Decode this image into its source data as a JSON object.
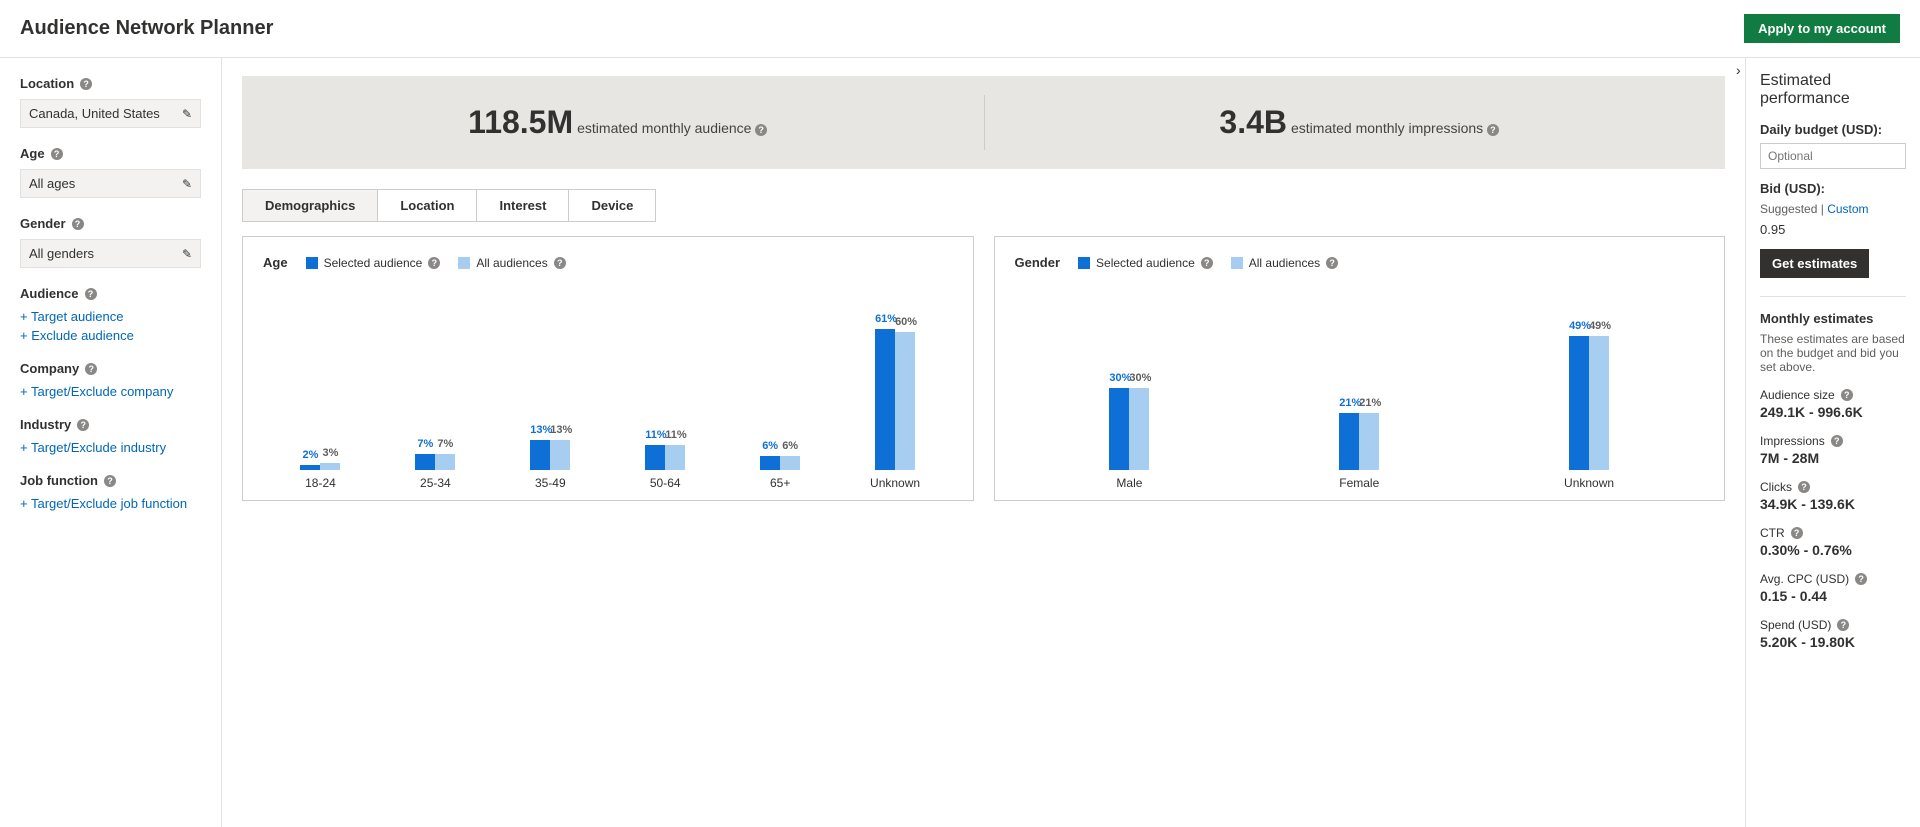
{
  "header": {
    "title": "Audience Network Planner",
    "apply_button": "Apply to my account"
  },
  "sidebar": {
    "location": {
      "label": "Location",
      "value": "Canada, United States"
    },
    "age": {
      "label": "Age",
      "value": "All ages"
    },
    "gender": {
      "label": "Gender",
      "value": "All genders"
    },
    "audience": {
      "label": "Audience",
      "target": "+ Target audience",
      "exclude": "+ Exclude audience"
    },
    "company": {
      "label": "Company",
      "link": "+ Target/Exclude company"
    },
    "industry": {
      "label": "Industry",
      "link": "+ Target/Exclude industry"
    },
    "jobfunction": {
      "label": "Job function",
      "link": "+ Target/Exclude job function"
    }
  },
  "summary": {
    "audience_value": "118.5M",
    "audience_label": "estimated monthly audience",
    "impressions_value": "3.4B",
    "impressions_label": "estimated monthly impressions"
  },
  "tabs": [
    "Demographics",
    "Location",
    "Interest",
    "Device"
  ],
  "charts": {
    "age": {
      "title": "Age",
      "legend1": "Selected audience",
      "legend2": "All audiences"
    },
    "gender": {
      "title": "Gender",
      "legend1": "Selected audience",
      "legend2": "All audiences"
    }
  },
  "rightpanel": {
    "title": "Estimated performance",
    "budget_label": "Daily budget (USD):",
    "budget_placeholder": "Optional",
    "bid_label": "Bid (USD):",
    "bid_suggested": "Suggested",
    "bid_custom": "Custom",
    "bid_value": "0.95",
    "get_estimates": "Get estimates",
    "monthly_title": "Monthly estimates",
    "monthly_desc": "These estimates are based on the budget and bid you set above.",
    "stats": {
      "audience_size": {
        "label": "Audience size",
        "value": "249.1K - 996.6K"
      },
      "impressions": {
        "label": "Impressions",
        "value": "7M - 28M"
      },
      "clicks": {
        "label": "Clicks",
        "value": "34.9K - 139.6K"
      },
      "ctr": {
        "label": "CTR",
        "value": "0.30% - 0.76%"
      },
      "avg_cpc": {
        "label": "Avg. CPC (USD)",
        "value": "0.15 - 0.44"
      },
      "spend": {
        "label": "Spend (USD)",
        "value": "5.20K - 19.80K"
      }
    }
  },
  "chart_data": [
    {
      "type": "bar",
      "title": "Age",
      "categories": [
        "18-24",
        "25-34",
        "35-49",
        "50-64",
        "65+",
        "Unknown"
      ],
      "series": [
        {
          "name": "Selected audience",
          "values": [
            2,
            7,
            13,
            11,
            6,
            61
          ]
        },
        {
          "name": "All audiences",
          "values": [
            3,
            7,
            13,
            11,
            6,
            60
          ]
        }
      ],
      "unit": "%",
      "ylim": [
        0,
        65
      ]
    },
    {
      "type": "bar",
      "title": "Gender",
      "categories": [
        "Male",
        "Female",
        "Unknown"
      ],
      "series": [
        {
          "name": "Selected audience",
          "values": [
            30,
            21,
            49
          ]
        },
        {
          "name": "All audiences",
          "values": [
            30,
            21,
            49
          ]
        }
      ],
      "unit": "%",
      "ylim": [
        0,
        55
      ]
    }
  ]
}
